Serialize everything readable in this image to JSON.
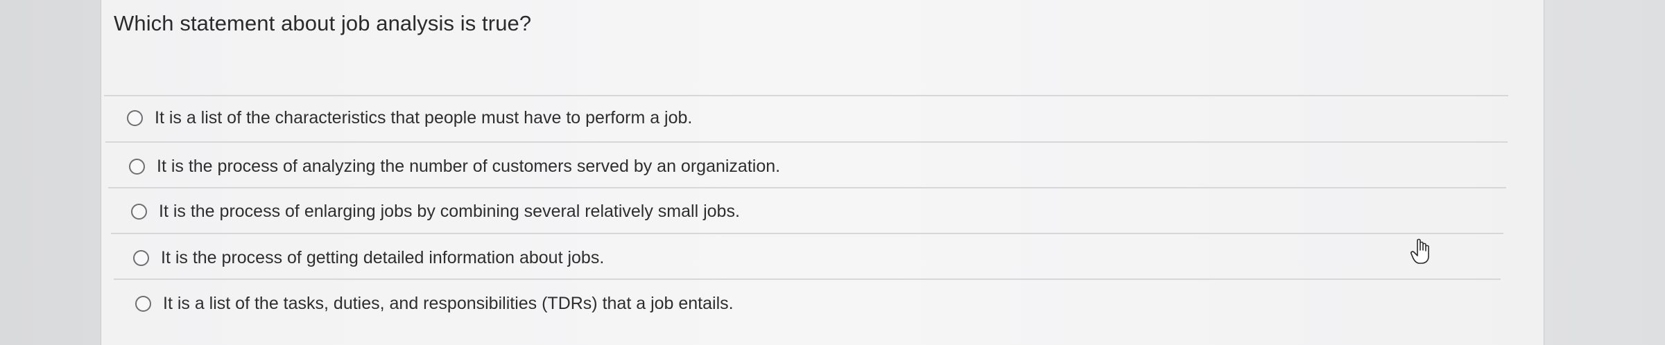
{
  "question": {
    "text": "Which statement about job analysis is true?"
  },
  "options": [
    {
      "label": "It is a list of the characteristics that people must have to perform a job."
    },
    {
      "label": "It is the process of analyzing the number of customers served by an organization."
    },
    {
      "label": "It is the process of enlarging jobs by combining several relatively small jobs."
    },
    {
      "label": "It is the process of getting detailed information about jobs."
    },
    {
      "label": "It is a list of the tasks, duties, and responsibilities (TDRs) that a job entails."
    }
  ],
  "cursor": {
    "icon": "hand-pointer-icon"
  }
}
